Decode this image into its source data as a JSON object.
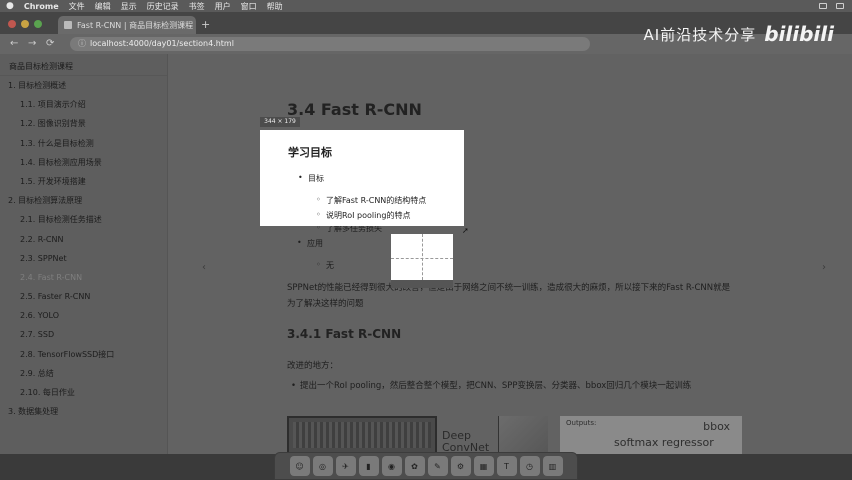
{
  "menubar": {
    "app_name": "Chrome",
    "items": [
      "文件",
      "编辑",
      "显示",
      "历史记录",
      "书签",
      "用户",
      "窗口",
      "帮助"
    ]
  },
  "browser": {
    "tab_title": "Fast R-CNN | 商品目标检测课程",
    "url": "localhost:4000/day01/section4.html"
  },
  "watermark": {
    "text": "AI前沿技术分享",
    "logo": "bilibili"
  },
  "sidebar": {
    "title": "商品目标检测课程",
    "items": [
      {
        "label": "1. 目标检测概述",
        "level": 1
      },
      {
        "label": "1.1. 项目演示介绍",
        "level": 2
      },
      {
        "label": "1.2. 图像识别背景",
        "level": 2
      },
      {
        "label": "1.3. 什么是目标检测",
        "level": 2
      },
      {
        "label": "1.4. 目标检测应用场景",
        "level": 2
      },
      {
        "label": "1.5. 开发环境搭建",
        "level": 2
      },
      {
        "label": "2. 目标检测算法原理",
        "level": 1
      },
      {
        "label": "2.1. 目标检测任务描述",
        "level": 2
      },
      {
        "label": "2.2. R-CNN",
        "level": 2
      },
      {
        "label": "2.3. SPPNet",
        "level": 2
      },
      {
        "label": "2.4. Fast R-CNN",
        "level": 2,
        "active": true
      },
      {
        "label": "2.5. Faster R-CNN",
        "level": 2
      },
      {
        "label": "2.6. YOLO",
        "level": 2
      },
      {
        "label": "2.7. SSD",
        "level": 2
      },
      {
        "label": "2.8. TensorFlowSSD接口",
        "level": 2
      },
      {
        "label": "2.9. 总结",
        "level": 2
      },
      {
        "label": "2.10. 每日作业",
        "level": 2
      },
      {
        "label": "3. 数据集处理",
        "level": 1
      }
    ]
  },
  "content": {
    "heading": "3.4 Fast R-CNN",
    "size_tip": "344 × 179",
    "card": {
      "title": "学习目标",
      "goal_label": "目标",
      "goal_items": [
        "了解Fast R-CNN的结构特点",
        "说明RoI pooling的特点"
      ],
      "goal_item_3": "了解多任务损失",
      "apply_label": "应用",
      "apply_item": "无"
    },
    "paragraph": "SPPNet的性能已经得到很大的改善，但是由于网络之间不统一训练，造成很大的麻烦，所以接下来的Fast R-CNN就是为了解决这样的问题",
    "subheading": "3.4.1 Fast R-CNN",
    "improve_label": "改进的地方：",
    "improve_item": "提出一个RoI pooling，然后整合整个模型，把CNN、SPP变换层、分类器、bbox回归几个模块一起训练",
    "figure": {
      "deep_label": "Deep",
      "convnet_label": "ConvNet",
      "outputs_label": "Outputs:",
      "bbox_label": "bbox",
      "softmax_label": "softmax",
      "regressor_label": "regressor"
    }
  },
  "dock": {
    "icons": [
      "finder",
      "safari",
      "launchpad",
      "terminal",
      "chrome",
      "photos",
      "notes",
      "settings",
      "trash"
    ]
  }
}
